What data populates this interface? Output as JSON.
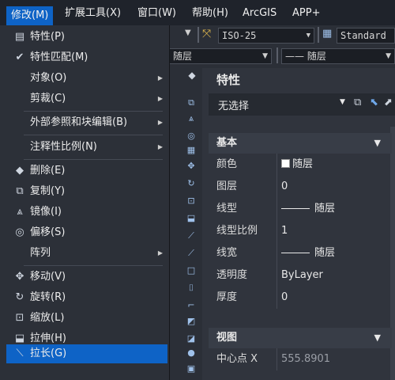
{
  "menubar": {
    "items": [
      {
        "label": "修改(M)",
        "active": true
      },
      {
        "label": "扩展工具(X)"
      },
      {
        "label": "窗口(W)"
      },
      {
        "label": "帮助(H)"
      },
      {
        "label": "ArcGIS"
      },
      {
        "label": "APP+"
      }
    ]
  },
  "toolbar": {
    "dimstyle_value": "ISO-25",
    "textstyle_value": "Standard",
    "layer_left_value": "随层",
    "layer_right_value": "—— 随层"
  },
  "menu": {
    "items": [
      {
        "label": "特性(P)",
        "icon": "properties-icon",
        "glyph": "▤"
      },
      {
        "label": "特性匹配(M)",
        "icon": "match-properties-icon",
        "glyph": "✔"
      },
      {
        "label": "对象(O)",
        "submenu": true
      },
      {
        "label": "剪裁(C)",
        "submenu": true
      },
      {
        "label": "外部参照和块编辑(B)",
        "submenu": true
      },
      {
        "label": "注释性比例(N)",
        "submenu": true
      },
      {
        "label": "删除(E)",
        "icon": "erase-icon",
        "glyph": "◆"
      },
      {
        "label": "复制(Y)",
        "icon": "copy-icon",
        "glyph": "⧉"
      },
      {
        "label": "镜像(I)",
        "icon": "mirror-icon",
        "glyph": "⩓"
      },
      {
        "label": "偏移(S)",
        "icon": "offset-icon",
        "glyph": "◎"
      },
      {
        "label": "阵列",
        "submenu": true
      },
      {
        "label": "移动(V)",
        "icon": "move-icon",
        "glyph": "✥"
      },
      {
        "label": "旋转(R)",
        "icon": "rotate-icon",
        "glyph": "↻"
      },
      {
        "label": "缩放(L)",
        "icon": "scale-icon",
        "glyph": "⊡"
      },
      {
        "label": "拉伸(H)",
        "icon": "stretch-icon",
        "glyph": "⬓"
      },
      {
        "label": "拉长(G)",
        "icon": "lengthen-icon",
        "glyph": "⟍",
        "highlighted": true
      }
    ]
  },
  "palette": {
    "title": "特性",
    "selection": "无选择",
    "sections": {
      "basic": "基本",
      "view": "视图"
    },
    "rows": [
      {
        "key": "颜色",
        "value": "随层"
      },
      {
        "key": "图层",
        "value": "0"
      },
      {
        "key": "线型",
        "value": "随层"
      },
      {
        "key": "线型比例",
        "value": "1"
      },
      {
        "key": "线宽",
        "value": "随层"
      },
      {
        "key": "透明度",
        "value": "ByLayer"
      },
      {
        "key": "厚度",
        "value": "0"
      }
    ],
    "view_rows": [
      {
        "key": "中心点 X",
        "value": "555.8901"
      }
    ]
  },
  "colors": {
    "accent": "#0e63c6",
    "menu_bg": "#2c3038",
    "palette_bg": "#30343d"
  }
}
